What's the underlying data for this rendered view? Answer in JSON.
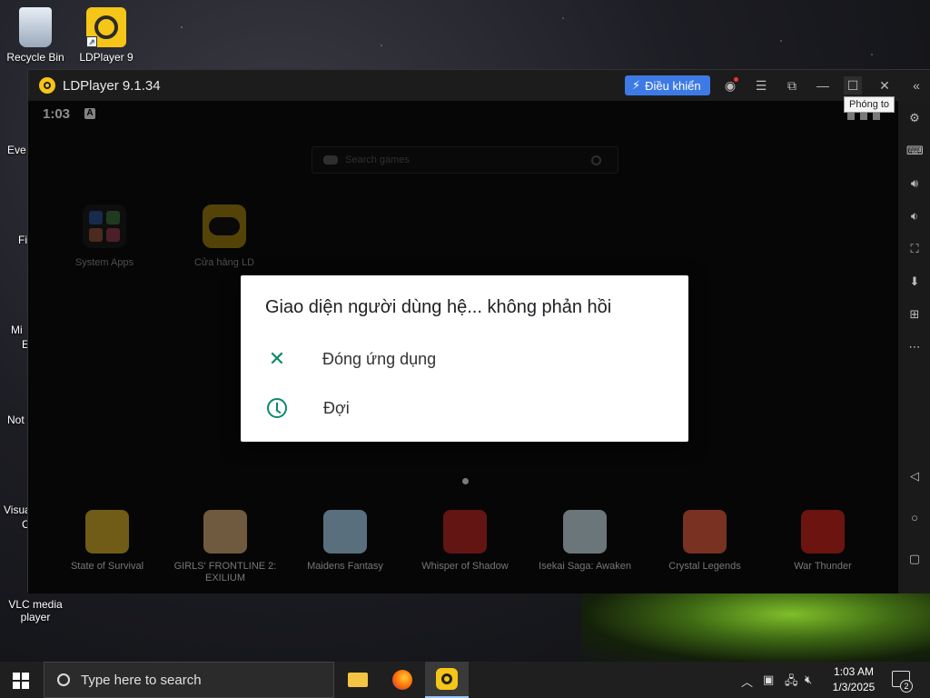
{
  "desktop": {
    "icons": [
      {
        "label": "Recycle Bin"
      },
      {
        "label": "LDPlayer 9"
      },
      {
        "label": "VLC media player"
      }
    ],
    "partial_labels": [
      "Eve",
      "Fi",
      "Mi",
      "E",
      "Not",
      "Visua",
      "C"
    ]
  },
  "emulator": {
    "title": "LDPlayer 9.1.34",
    "control_button": "Điều khiển",
    "tooltip": "Phóng to",
    "android": {
      "status_time": "1:03",
      "status_badge": "A",
      "search_placeholder": "Search games",
      "apps": [
        {
          "label": "System Apps"
        },
        {
          "label": "Cửa hàng LD"
        }
      ],
      "games": [
        {
          "label": "State of Survival"
        },
        {
          "label": "GIRLS' FRONTLINE 2: EXILIUM"
        },
        {
          "label": "Maidens Fantasy"
        },
        {
          "label": "Whisper of Shadow"
        },
        {
          "label": "Isekai Saga: Awaken"
        },
        {
          "label": "Crystal Legends"
        },
        {
          "label": "War Thunder"
        }
      ],
      "dialog": {
        "title": "Giao diện người dùng hệ... không phản hồi",
        "options": [
          {
            "label": "Đóng ứng dụng",
            "icon": "close-icon"
          },
          {
            "label": "Đợi",
            "icon": "clock-icon"
          }
        ]
      }
    }
  },
  "taskbar": {
    "search_placeholder": "Type here to search",
    "time": "1:03 AM",
    "date": "1/3/2025",
    "notification_count": "2"
  },
  "colors": {
    "accent_teal": "#0a8a6b",
    "control_blue": "#3d7ae5",
    "ld_yellow": "#f5c518"
  }
}
